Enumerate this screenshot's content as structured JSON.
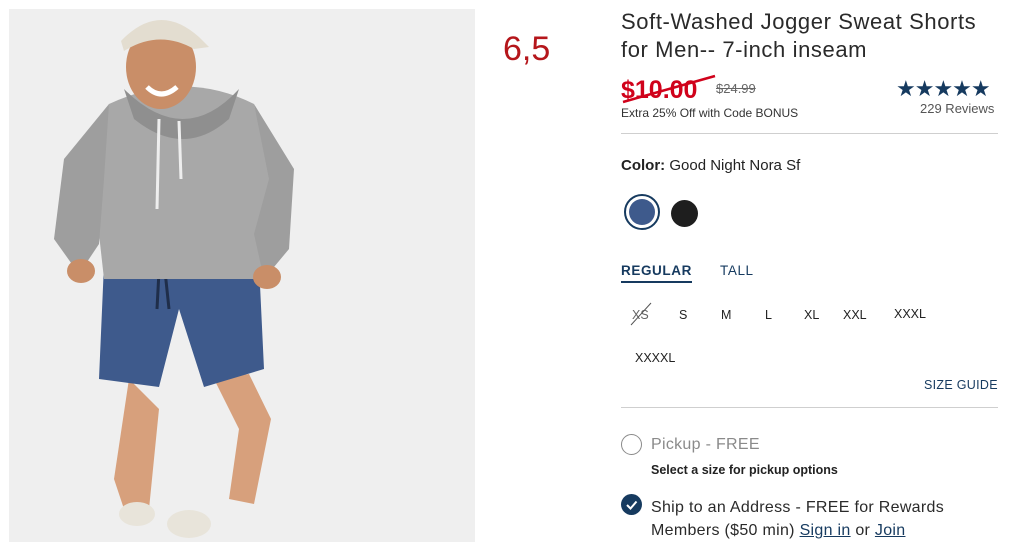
{
  "annotation": "6,5",
  "product": {
    "title": "Soft-Washed Jogger Sweat Shorts for Men-- 7-inch inseam",
    "sale_price": "$10.00",
    "original_price": "$24.99",
    "promo": "Extra 25% Off with Code BONUS",
    "rating": {
      "stars": "★★★★★",
      "value": 5,
      "reviews": "229 Reviews"
    }
  },
  "color": {
    "label": "Color:",
    "selected": "Good Night Nora Sf",
    "swatches": [
      {
        "name": "blue-heather",
        "hex": "#3e5a8c",
        "selected": true
      },
      {
        "name": "black",
        "hex": "#1e1e1e",
        "selected": false
      }
    ]
  },
  "fit": {
    "options": [
      "REGULAR",
      "TALL"
    ],
    "selected": "REGULAR"
  },
  "sizes": {
    "items": [
      "XS",
      "S",
      "M",
      "L",
      "XL",
      "XXL",
      "XXXL",
      "XXXXL"
    ],
    "unavailable": [
      "XS"
    ],
    "guide": "SIZE GUIDE"
  },
  "fulfillment": {
    "pickup_label": "Pickup - FREE",
    "pickup_note": "Select a size for pickup options",
    "ship_text": "Ship to an Address - FREE for Rewards Members ($50 min)",
    "sign_in": "Sign in",
    "or": "or",
    "join": "Join"
  },
  "colors": {
    "brand_navy": "#163a5f",
    "sale_red": "#d0021b"
  }
}
